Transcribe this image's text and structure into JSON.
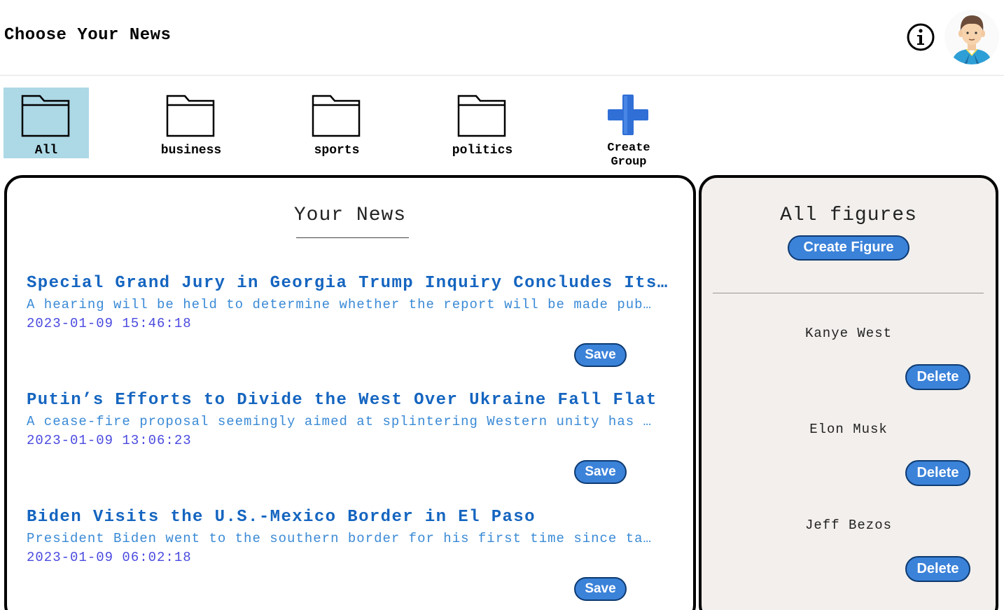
{
  "header": {
    "title": "Choose Your News",
    "info_icon": "info-circle-icon",
    "avatar_icon": "user-avatar-icon"
  },
  "groups": {
    "items": [
      {
        "label": "All",
        "icon": "folder-icon",
        "active": true
      },
      {
        "label": "business",
        "icon": "folder-icon",
        "active": false
      },
      {
        "label": "sports",
        "icon": "folder-icon",
        "active": false
      },
      {
        "label": "politics",
        "icon": "folder-icon",
        "active": false
      }
    ],
    "create_label": "Create\nGroup",
    "create_icon": "plus-icon"
  },
  "news": {
    "heading": "Your News",
    "save_label": "Save",
    "articles": [
      {
        "title": "Special Grand Jury in Georgia Trump Inquiry Concludes Its Work",
        "description": "A hearing will be held to determine whether the report will be made public.",
        "date": "2023-01-09 15:46:18"
      },
      {
        "title": "Putin’s Efforts to Divide the West Over Ukraine Fall Flat",
        "description": "A cease-fire proposal seemingly aimed at splintering Western unity has fallen flat.",
        "date": "2023-01-09 13:06:23"
      },
      {
        "title": "Biden Visits the U.S.-Mexico Border in El Paso",
        "description": "President Biden went to the southern border for his first time since taking office.",
        "date": "2023-01-09 06:02:18"
      }
    ]
  },
  "figures": {
    "heading": "All figures",
    "create_label": "Create Figure",
    "delete_label": "Delete",
    "items": [
      {
        "name": "Kanye West"
      },
      {
        "name": "Elon Musk"
      },
      {
        "name": "Jeff Bezos"
      }
    ]
  },
  "colors": {
    "accent": "#3b82d9",
    "active_group": "#add8e6",
    "title_link": "#1565c0",
    "figures_bg": "#f2efec"
  }
}
